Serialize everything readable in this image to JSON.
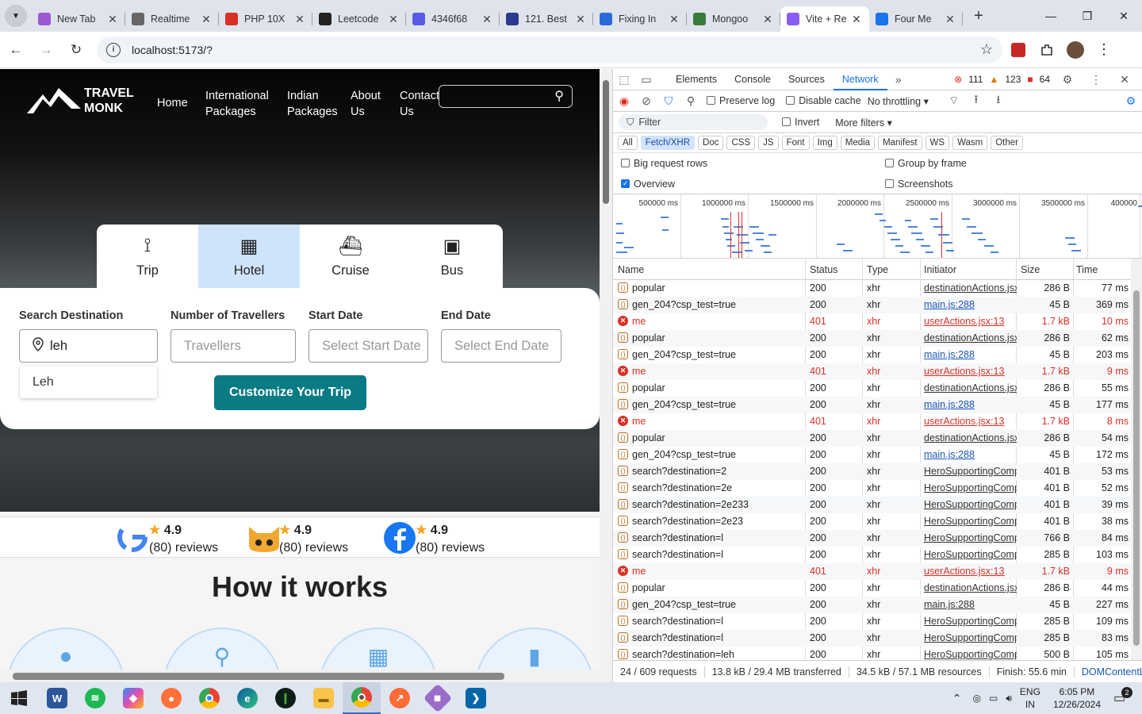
{
  "browser": {
    "tabs": [
      {
        "title": "New Tab",
        "color": "#9b59d0"
      },
      {
        "title": "Realtime",
        "color": "#666666"
      },
      {
        "title": "PHP 10X",
        "color": "#d93025"
      },
      {
        "title": "Leetcode",
        "color": "#222222"
      },
      {
        "title": "4346f68",
        "color": "#5a5ae6"
      },
      {
        "title": "121. Best",
        "color": "#2b3a8c"
      },
      {
        "title": "Fixing In",
        "color": "#2a6ad8"
      },
      {
        "title": "Mongoo",
        "color": "#3a7a3a"
      },
      {
        "title": "Vite + Re",
        "color": "#8a5cf6",
        "active": true
      },
      {
        "title": "Four Me",
        "color": "#1a73e8"
      }
    ],
    "url": "localhost:5173/?"
  },
  "site": {
    "logo_line1": "TRAVEL",
    "logo_line2": "MONK",
    "nav": [
      {
        "l1": "Home",
        "l2": ""
      },
      {
        "l1": "International",
        "l2": "Packages"
      },
      {
        "l1": "Indian",
        "l2": "Packages"
      },
      {
        "l1": "About",
        "l2": "Us"
      },
      {
        "l1": "Contact",
        "l2": "Us"
      }
    ],
    "modes": [
      {
        "label": "Trip",
        "icon": "route-icon"
      },
      {
        "label": "Hotel",
        "icon": "hotel-icon",
        "selected": true
      },
      {
        "label": "Cruise",
        "icon": "ship-icon"
      },
      {
        "label": "Bus",
        "icon": "bus-icon"
      }
    ],
    "form": {
      "dest_label": "Search Destination",
      "dest_value": "leh",
      "trav_label": "Number of Travellers",
      "trav_placeholder": "Travellers",
      "start_label": "Start Date",
      "start_placeholder": "Select Start Date",
      "end_label": "End Date",
      "end_placeholder": "Select End Date",
      "suggestion": "Leh",
      "cta": "Customize Your Trip"
    },
    "reviews": [
      {
        "rating": "4.9",
        "count": "(80) reviews",
        "icon": "google-icon"
      },
      {
        "rating": "4.9",
        "count": "(80) reviews",
        "icon": "github-icon"
      },
      {
        "rating": "4.9",
        "count": "(80) reviews",
        "icon": "facebook-icon"
      }
    ],
    "how_title": "How it works"
  },
  "devtools": {
    "tabs": [
      "Elements",
      "Console",
      "Sources",
      "Network"
    ],
    "errors": "111",
    "warnings": "123",
    "issues": "64",
    "preserve_log": "Preserve log",
    "disable_cache": "Disable cache",
    "throttle": "No throttling",
    "filter_placeholder": "Filter",
    "invert": "Invert",
    "more_filters": "More filters",
    "types": [
      "All",
      "Fetch/XHR",
      "Doc",
      "CSS",
      "JS",
      "Font",
      "Img",
      "Media",
      "Manifest",
      "WS",
      "Wasm",
      "Other"
    ],
    "big_rows": "Big request rows",
    "group_frame": "Group by frame",
    "overview": "Overview",
    "screenshots": "Screenshots",
    "timeline_labels": [
      "500000 ms",
      "1000000 ms",
      "1500000 ms",
      "2000000 ms",
      "2500000 ms",
      "3000000 ms",
      "3500000 ms",
      "400000"
    ],
    "columns": [
      "Name",
      "Status",
      "Type",
      "Initiator",
      "Size",
      "Time"
    ],
    "requests": [
      {
        "name": "popular",
        "status": "200",
        "type": "xhr",
        "initiator": "destinationActions.jsx:",
        "size": "286 B",
        "time": "77 ms"
      },
      {
        "name": "gen_204?csp_test=true",
        "status": "200",
        "type": "xhr",
        "initiator": "main.js:288",
        "size": "45 B",
        "time": "369 ms",
        "link": true
      },
      {
        "name": "me",
        "status": "401",
        "type": "xhr",
        "initiator": "userActions.jsx:13",
        "size": "1.7 kB",
        "time": "10 ms",
        "error": true
      },
      {
        "name": "popular",
        "status": "200",
        "type": "xhr",
        "initiator": "destinationActions.jsx:",
        "size": "286 B",
        "time": "62 ms"
      },
      {
        "name": "gen_204?csp_test=true",
        "status": "200",
        "type": "xhr",
        "initiator": "main.js:288",
        "size": "45 B",
        "time": "203 ms",
        "link": true
      },
      {
        "name": "me",
        "status": "401",
        "type": "xhr",
        "initiator": "userActions.jsx:13",
        "size": "1.7 kB",
        "time": "9 ms",
        "error": true
      },
      {
        "name": "popular",
        "status": "200",
        "type": "xhr",
        "initiator": "destinationActions.jsx:",
        "size": "286 B",
        "time": "55 ms"
      },
      {
        "name": "gen_204?csp_test=true",
        "status": "200",
        "type": "xhr",
        "initiator": "main.js:288",
        "size": "45 B",
        "time": "177 ms",
        "link": true
      },
      {
        "name": "me",
        "status": "401",
        "type": "xhr",
        "initiator": "userActions.jsx:13",
        "size": "1.7 kB",
        "time": "8 ms",
        "error": true
      },
      {
        "name": "popular",
        "status": "200",
        "type": "xhr",
        "initiator": "destinationActions.jsx:",
        "size": "286 B",
        "time": "54 ms"
      },
      {
        "name": "gen_204?csp_test=true",
        "status": "200",
        "type": "xhr",
        "initiator": "main.js:288",
        "size": "45 B",
        "time": "172 ms",
        "link": true
      },
      {
        "name": "search?destination=2",
        "status": "200",
        "type": "xhr",
        "initiator": "HeroSupportingComp",
        "size": "401 B",
        "time": "53 ms"
      },
      {
        "name": "search?destination=2e",
        "status": "200",
        "type": "xhr",
        "initiator": "HeroSupportingComp",
        "size": "401 B",
        "time": "52 ms"
      },
      {
        "name": "search?destination=2e233",
        "status": "200",
        "type": "xhr",
        "initiator": "HeroSupportingComp",
        "size": "401 B",
        "time": "39 ms"
      },
      {
        "name": "search?destination=2e23",
        "status": "200",
        "type": "xhr",
        "initiator": "HeroSupportingComp",
        "size": "401 B",
        "time": "38 ms"
      },
      {
        "name": "search?destination=l",
        "status": "200",
        "type": "xhr",
        "initiator": "HeroSupportingComp",
        "size": "766 B",
        "time": "84 ms"
      },
      {
        "name": "search?destination=l",
        "status": "200",
        "type": "xhr",
        "initiator": "HeroSupportingComp",
        "size": "285 B",
        "time": "103 ms"
      },
      {
        "name": "me",
        "status": "401",
        "type": "xhr",
        "initiator": "userActions.jsx:13",
        "size": "1.7 kB",
        "time": "9 ms",
        "error": true
      },
      {
        "name": "popular",
        "status": "200",
        "type": "xhr",
        "initiator": "destinationActions.jsx:",
        "size": "286 B",
        "time": "44 ms"
      },
      {
        "name": "gen_204?csp_test=true",
        "status": "200",
        "type": "xhr",
        "initiator": "main.js:288",
        "size": "45 B",
        "time": "227 ms"
      },
      {
        "name": "search?destination=l",
        "status": "200",
        "type": "xhr",
        "initiator": "HeroSupportingComp",
        "size": "285 B",
        "time": "109 ms"
      },
      {
        "name": "search?destination=l",
        "status": "200",
        "type": "xhr",
        "initiator": "HeroSupportingComp",
        "size": "285 B",
        "time": "83 ms"
      },
      {
        "name": "search?destination=leh",
        "status": "200",
        "type": "xhr",
        "initiator": "HeroSupportingComp",
        "size": "500 B",
        "time": "105 ms"
      }
    ],
    "status": {
      "requests": "24 / 609 requests",
      "transferred": "13.8 kB / 29.4 MB transferred",
      "resources": "34.5 kB / 57.1 MB resources",
      "finish": "Finish: 55.6 min",
      "dcl": "DOMContentLoaded"
    }
  },
  "taskbar": {
    "lang1": "ENG",
    "lang2": "IN",
    "time": "6:05 PM",
    "date": "12/26/2024",
    "notif": "2"
  }
}
